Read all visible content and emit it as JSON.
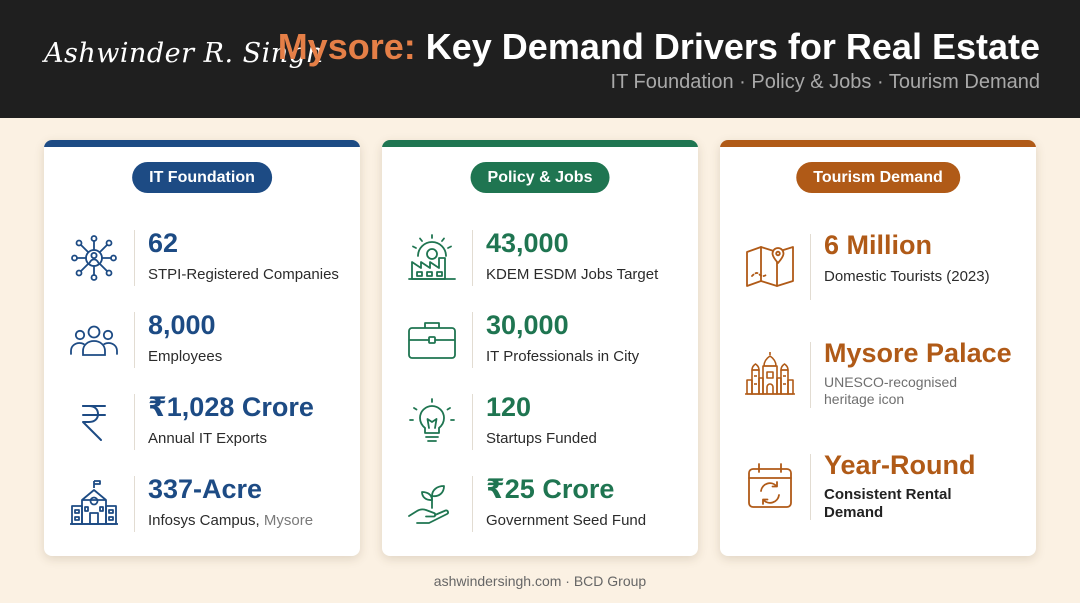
{
  "header": {
    "signature": "Ashwinder R. Singh",
    "title_accent": "Mysore:",
    "title_rest": "Key Demand Drivers for Real Estate",
    "subtitle": "IT Foundation · Policy & Jobs · Tourism Demand"
  },
  "colors": {
    "blue": "#1d4b84",
    "green": "#1f7551",
    "orange": "#b05a17",
    "accent": "#e57f47"
  },
  "cards": [
    {
      "title": "IT Foundation",
      "items": [
        {
          "icon": "network-people-icon",
          "value": "62",
          "label": "STPI-Registered Companies"
        },
        {
          "icon": "people-group-icon",
          "value": "8,000",
          "label": "Employees"
        },
        {
          "icon": "rupee-icon",
          "value": "₹1,028 Crore",
          "label": "Annual IT Exports"
        },
        {
          "icon": "campus-building-icon",
          "value": "337-Acre",
          "label": "Infosys Campus,",
          "label_muted": "Mysore"
        }
      ]
    },
    {
      "title": "Policy & Jobs",
      "items": [
        {
          "icon": "factory-gear-icon",
          "value": "43,000",
          "label": "KDEM ESDM Jobs Target"
        },
        {
          "icon": "briefcase-icon",
          "value": "30,000",
          "label": "IT Professionals in City"
        },
        {
          "icon": "lightbulb-icon",
          "value": "120",
          "label": "Startups Funded"
        },
        {
          "icon": "plant-hand-icon",
          "value": "₹25 Crore",
          "label": "Government Seed Fund"
        }
      ]
    },
    {
      "title": "Tourism Demand",
      "items": [
        {
          "icon": "map-pin-icon",
          "value": "6 Million",
          "label": "Domestic Tourists (2023)"
        },
        {
          "icon": "palace-icon",
          "value": "Mysore Palace",
          "label_line1": "UNESCO-recognised",
          "label_line2": "heritage icon"
        },
        {
          "icon": "calendar-cycle-icon",
          "value": "Year-Round",
          "label_line1": "Consistent Rental",
          "label_line2": "Demand"
        }
      ]
    }
  ],
  "footer": "ashwindersingh.com · BCD Group"
}
